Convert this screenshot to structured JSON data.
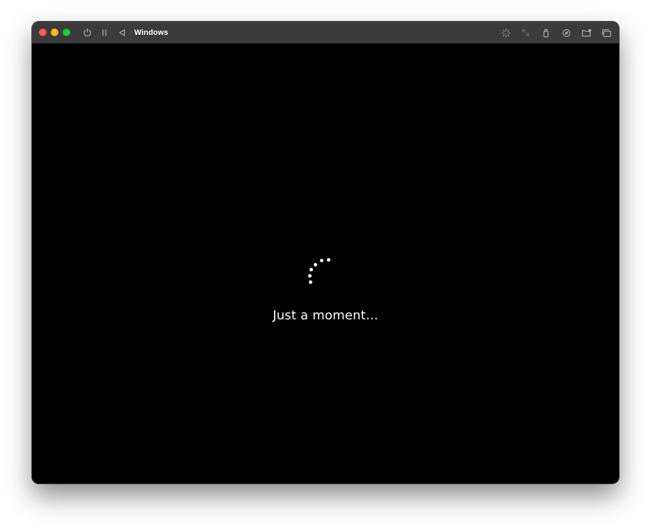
{
  "window": {
    "title": "Windows"
  },
  "titlebar": {
    "left_icons": [
      "power-icon",
      "pause-icon",
      "back-icon"
    ],
    "right_icons": [
      "brightness-icon",
      "resize-icon",
      "usb-icon",
      "audio-icon",
      "shared-folder-icon",
      "window-icon"
    ]
  },
  "screen": {
    "status": "Just a moment..."
  },
  "colors": {
    "titlebar": "#3b3b3d",
    "screen": "#000000",
    "close": "#ff5f57",
    "minimize": "#febc2e",
    "zoom": "#28c840"
  }
}
